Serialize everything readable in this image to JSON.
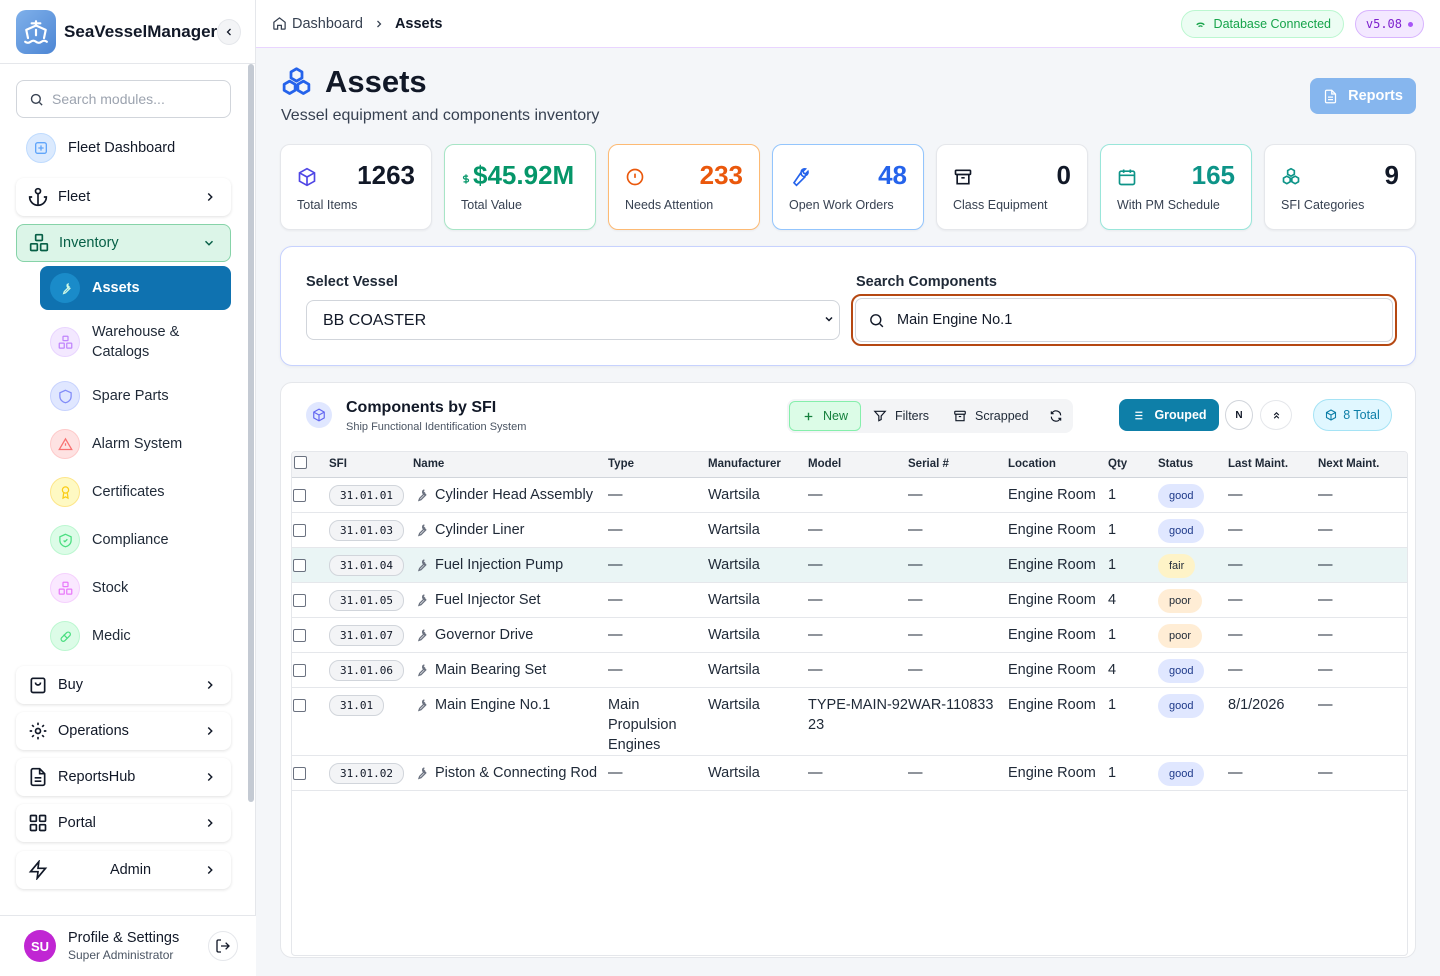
{
  "brand": {
    "title": "SeaVesselManager"
  },
  "sidebar": {
    "search_placeholder": "Search modules...",
    "fleet_dashboard": "Fleet Dashboard",
    "groups": {
      "fleet": "Fleet",
      "inventory": "Inventory",
      "buy": "Buy",
      "operations": "Operations",
      "reportshub": "ReportsHub",
      "portal": "Portal",
      "admin": "Admin"
    },
    "inventory_items": [
      "Assets",
      "Warehouse & Catalogs",
      "Spare Parts",
      "Alarm System",
      "Certificates",
      "Compliance",
      "Stock",
      "Medic"
    ],
    "profile": {
      "initials": "SU",
      "name": "Profile & Settings",
      "role": "Super Administrator"
    }
  },
  "topbar": {
    "breadcrumb": [
      "Dashboard",
      "Assets"
    ],
    "db_status": "Database Connected",
    "version": "v5.08"
  },
  "page": {
    "title": "Assets",
    "subtitle": "Vessel equipment and components inventory",
    "reports_label": "Reports"
  },
  "stats": [
    {
      "value": "1263",
      "label": "Total Items",
      "color": "#111827"
    },
    {
      "value": "$45.92M",
      "label": "Total Value",
      "color": "#059669"
    },
    {
      "value": "233",
      "label": "Needs Attention",
      "color": "#ea580c"
    },
    {
      "value": "48",
      "label": "Open Work Orders",
      "color": "#2563eb"
    },
    {
      "value": "0",
      "label": "Class Equipment",
      "color": "#111827"
    },
    {
      "value": "165",
      "label": "With PM Schedule",
      "color": "#0d9488"
    },
    {
      "value": "9",
      "label": "SFI Categories",
      "color": "#111827"
    }
  ],
  "filters": {
    "vessel_label": "Select Vessel",
    "vessel_value": "BB COASTER",
    "search_label": "Search Components",
    "search_value": "Main Engine No.1"
  },
  "components": {
    "title": "Components by SFI",
    "subtitle": "Ship Functional Identification System",
    "toolbar": {
      "new": "New",
      "filters": "Filters",
      "scrapped": "Scrapped",
      "grouped": "Grouped",
      "n_toggle": "N",
      "total": "8 Total"
    },
    "columns": [
      "SFI",
      "Name",
      "Type",
      "Manufacturer",
      "Model",
      "Serial #",
      "Location",
      "Qty",
      "Status",
      "Last Maint.",
      "Next Maint."
    ],
    "rows": [
      {
        "sfi": "31.01.01",
        "name": "Cylinder Head Assembly",
        "type": "—",
        "manufacturer": "Wartsila",
        "model": "—",
        "serial": "—",
        "location": "Engine Room",
        "qty": "1",
        "status": "good",
        "last": "—",
        "next": "—"
      },
      {
        "sfi": "31.01.03",
        "name": "Cylinder Liner",
        "type": "—",
        "manufacturer": "Wartsila",
        "model": "—",
        "serial": "—",
        "location": "Engine Room",
        "qty": "1",
        "status": "good",
        "last": "—",
        "next": "—"
      },
      {
        "sfi": "31.01.04",
        "name": "Fuel Injection Pump",
        "type": "—",
        "manufacturer": "Wartsila",
        "model": "—",
        "serial": "—",
        "location": "Engine Room",
        "qty": "1",
        "status": "fair",
        "last": "—",
        "next": "—"
      },
      {
        "sfi": "31.01.05",
        "name": "Fuel Injector Set",
        "type": "—",
        "manufacturer": "Wartsila",
        "model": "—",
        "serial": "—",
        "location": "Engine Room",
        "qty": "4",
        "status": "poor",
        "last": "—",
        "next": "—"
      },
      {
        "sfi": "31.01.07",
        "name": "Governor Drive",
        "type": "—",
        "manufacturer": "Wartsila",
        "model": "—",
        "serial": "—",
        "location": "Engine Room",
        "qty": "1",
        "status": "poor",
        "last": "—",
        "next": "—"
      },
      {
        "sfi": "31.01.06",
        "name": "Main Bearing Set",
        "type": "—",
        "manufacturer": "Wartsila",
        "model": "—",
        "serial": "—",
        "location": "Engine Room",
        "qty": "4",
        "status": "good",
        "last": "—",
        "next": "—"
      },
      {
        "sfi": "31.01",
        "name": "Main Engine No.1",
        "type": "Main Propulsion Engines",
        "manufacturer": "Wartsila",
        "model": "TYPE-MAIN-9223",
        "serial": "WAR-110833",
        "location": "Engine Room",
        "qty": "1",
        "status": "good",
        "last": "8/1/2026",
        "next": "—"
      },
      {
        "sfi": "31.01.02",
        "name": "Piston & Connecting Rod",
        "type": "—",
        "manufacturer": "Wartsila",
        "model": "—",
        "serial": "—",
        "location": "Engine Room",
        "qty": "1",
        "status": "good",
        "last": "—",
        "next": "—"
      }
    ]
  }
}
